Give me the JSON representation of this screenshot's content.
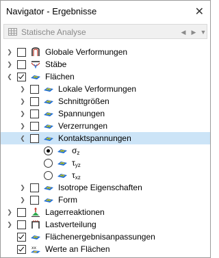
{
  "window": {
    "title": "Navigator - Ergebnisse",
    "close_glyph": "✕"
  },
  "toolbar": {
    "label": "Statische Analyse",
    "icon": "grid-icon",
    "prev_glyph": "◀",
    "next_glyph": "▶",
    "drop_glyph": "▼"
  },
  "tree": {
    "globale": "Globale Verformungen",
    "staebe": "Stäbe",
    "flaechen": "Flächen",
    "lokale": "Lokale Verformungen",
    "schnitt": "Schnittgrößen",
    "spannungen": "Spannungen",
    "verzerrungen": "Verzerrungen",
    "kontakt": "Kontaktspannungen",
    "sigma": "σ",
    "sigma_sub": "z",
    "tau_yz": "τ",
    "tau_yz_sub": "yz",
    "tau_xz": "τ",
    "tau_xz_sub": "xz",
    "isotrope": "Isotrope Eigenschaften",
    "form": "Form",
    "lager": "Lagerreaktionen",
    "last": "Lastverteilung",
    "anpass": "Flächenergebnisanpassungen",
    "werte": "Werte an Flächen"
  },
  "colors": {
    "selection": "#cce4f7",
    "accent_red": "#c0392b",
    "surface_blue": "#1e6fd9",
    "surface_yellow": "#f3c312",
    "surface_green": "#2fa84f"
  }
}
